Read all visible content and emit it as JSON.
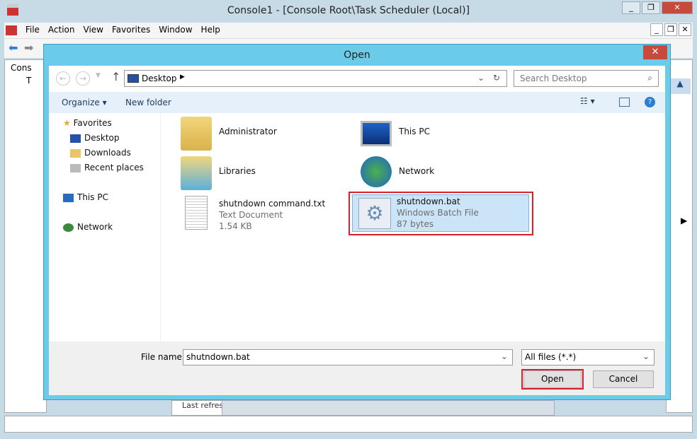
{
  "mmc": {
    "title": "Console1 - [Console Root\\Task Scheduler (Local)]",
    "menu": [
      "File",
      "Action",
      "View",
      "Favorites",
      "Window",
      "Help"
    ],
    "tree": [
      "Cons",
      "T"
    ],
    "panel_text": "Last refresh"
  },
  "dialog": {
    "title": "Open",
    "address": "Desktop",
    "search_placeholder": "Search Desktop",
    "organize": "Organize",
    "new_folder": "New folder",
    "nav": {
      "favorites": "Favorites",
      "items": [
        "Desktop",
        "Downloads",
        "Recent places"
      ],
      "this_pc": "This PC",
      "network": "Network"
    },
    "files": [
      {
        "name": "Administrator",
        "icon": "user-folder-icon"
      },
      {
        "name": "This PC",
        "icon": "computer-icon"
      },
      {
        "name": "Libraries",
        "icon": "libraries-icon"
      },
      {
        "name": "Network",
        "icon": "network-icon"
      },
      {
        "name": "shutndown command.txt",
        "type": "Text Document",
        "size": "1.54 KB",
        "icon": "text-document-icon"
      },
      {
        "name": "shutndown.bat",
        "type": "Windows Batch File",
        "size": "87 bytes",
        "icon": "batch-file-icon",
        "selected": true
      }
    ],
    "file_name_label": "File name:",
    "file_name_value": "shutndown.bat",
    "file_type": "All files (*.*)",
    "open": "Open",
    "cancel": "Cancel"
  },
  "colors": {
    "dialog_frame": "#6ccbe8",
    "highlight": "#d7202a",
    "selection": "#cce4f7"
  }
}
